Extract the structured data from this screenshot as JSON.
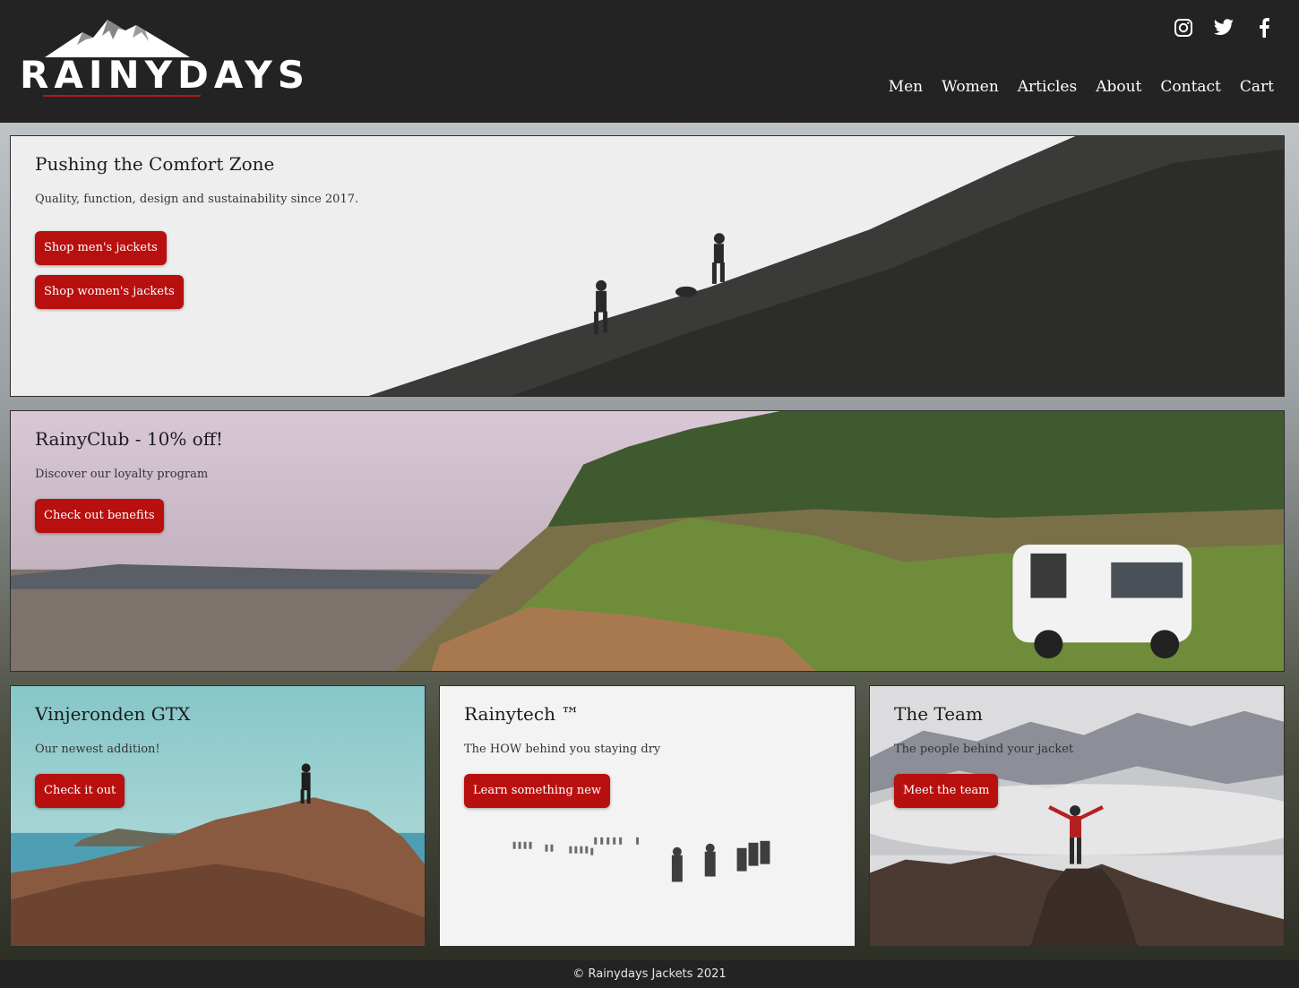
{
  "brand": {
    "name": "RAINYDAYS",
    "accent_color": "#b8100f"
  },
  "social": [
    {
      "icon": "instagram-icon"
    },
    {
      "icon": "twitter-icon"
    },
    {
      "icon": "facebook-icon"
    }
  ],
  "nav": {
    "items": [
      {
        "label": "Men"
      },
      {
        "label": "Women"
      },
      {
        "label": "Articles"
      },
      {
        "label": "About"
      },
      {
        "label": "Contact"
      },
      {
        "label": "Cart"
      }
    ]
  },
  "hero": {
    "title": "Pushing the Comfort Zone",
    "subtitle": "Quality, function, design and sustainability since 2017.",
    "buttons": [
      "Shop men's jackets",
      "Shop women's jackets"
    ]
  },
  "club": {
    "title": "RainyClub - 10% off!",
    "subtitle": "Discover our loyalty program",
    "button": "Check out benefits"
  },
  "cards": [
    {
      "title": "Vinjeronden GTX",
      "subtitle": "Our newest addition!",
      "button": "Check it out"
    },
    {
      "title": "Rainytech ™",
      "subtitle": "The HOW behind you staying dry",
      "button": "Learn something new"
    },
    {
      "title": "The Team",
      "subtitle": "The people behind your jacket",
      "button": "Meet the team"
    }
  ],
  "footer": {
    "text": "© Rainydays Jackets 2021"
  }
}
